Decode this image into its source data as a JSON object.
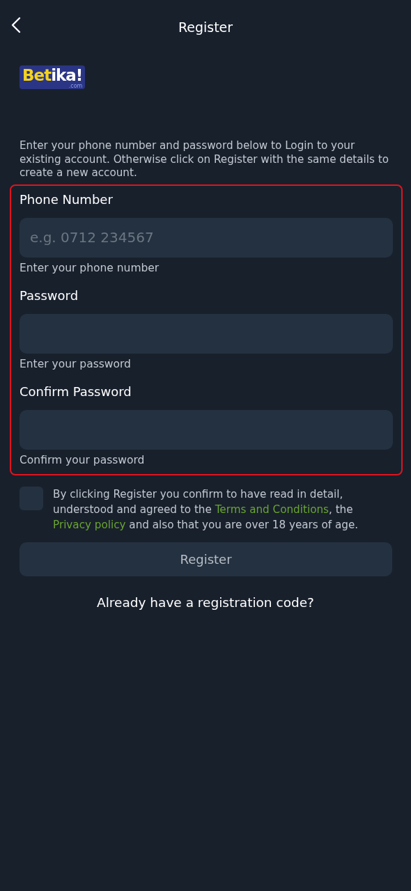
{
  "header": {
    "title": "Register"
  },
  "logo": {
    "part_1": "Bet",
    "part_2": "ika!",
    "domain": ".com"
  },
  "intro": "Enter your phone number and password below to Login to your existing account. Otherwise click on Register with the same details to create a new account.",
  "form": {
    "highlighted": true,
    "fields": [
      {
        "label": "Phone Number",
        "placeholder": "e.g. 0712 234567",
        "hint": "Enter your phone number"
      },
      {
        "label": "Password",
        "hint": "Enter your password"
      },
      {
        "label": "Confirm Password",
        "hint": "Confirm your password"
      }
    ]
  },
  "consent": {
    "checked": false,
    "parts": [
      {
        "kind": "text",
        "text": "By clicking Register you confirm to have read in detail, understood and agreed to the "
      },
      {
        "kind": "link",
        "text": "Terms and Conditions"
      },
      {
        "kind": "text",
        "text": ", the "
      },
      {
        "kind": "link",
        "text": "Privacy policy"
      },
      {
        "kind": "text",
        "text": " and also that you are over 18 years of age."
      }
    ]
  },
  "register_button": {
    "label": "Register",
    "disabled": true
  },
  "registration_code_link": "Already have a registration code?"
}
